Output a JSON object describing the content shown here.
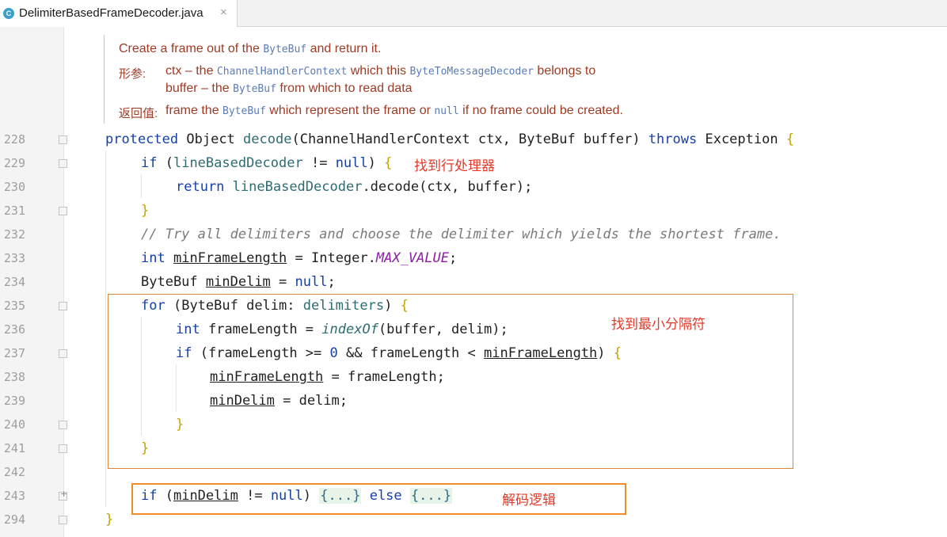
{
  "tab": {
    "title": "DelimiterBasedFrameDecoder.java",
    "close": "×",
    "icon": "C"
  },
  "doc": {
    "line1_a": "Create a frame out of the ",
    "line1_code": "ByteBuf",
    "line1_b": " and return it.",
    "params_label": "形参:",
    "param1_a": "ctx – the ",
    "param1_code": "ChannelHandlerContext",
    "param1_b": " which this ",
    "param1_code2": "ByteToMessageDecoder",
    "param1_c": " belongs to",
    "param2_a": "buffer – the ",
    "param2_code": "ByteBuf",
    "param2_b": " from which to read data",
    "returns_label": "返回值:",
    "returns_a": "frame the ",
    "returns_code": "ByteBuf",
    "returns_b": " which represent the frame or ",
    "returns_code2": "null",
    "returns_c": " if no frame could be created."
  },
  "line_numbers": [
    "228",
    "229",
    "230",
    "231",
    "232",
    "233",
    "234",
    "235",
    "236",
    "237",
    "238",
    "239",
    "240",
    "241",
    "242",
    "243",
    "294"
  ],
  "annotations": {
    "line_decoder": "找到行处理器",
    "min_delim": "找到最小分隔符",
    "decode_logic": "解码逻辑"
  },
  "code": {
    "protected": "protected",
    "object": "Object",
    "decode": "decode",
    "sig_params": "(ChannelHandlerContext ctx, ByteBuf buffer) ",
    "throws": "throws",
    "exception": " Exception ",
    "if": "if",
    "line_based": "lineBasedDecoder",
    "neq": " != ",
    "null": "null",
    "return": "return",
    "decode_call": ".decode(ctx, buffer);",
    "comment": "// Try all delimiters and choose the delimiter which yields the shortest frame.",
    "int": "int",
    "min_frame_length": "minFrameLength",
    "eq": " = ",
    "integer": "Integer.",
    "max_value": "MAX_VALUE",
    "bytebuf": "ByteBuf",
    "min_delim": "minDelim",
    "for": "for",
    "for_decl": "(ByteBuf delim: ",
    "delimiters": "delimiters",
    "frame_length": "frameLength",
    "index_of": "indexOf",
    "index_args": "(buffer, delim);",
    "cond_a": "(frameLength >= ",
    "zero": "0",
    "cond_b": " && frameLength < ",
    "assign_fl": "frameLength;",
    "assign_delim": "delim;",
    "folded": "{...}",
    "else": "else",
    "open_brace": "{",
    "close_brace": "}",
    "semicolon": ";",
    "close_paren": ")"
  }
}
